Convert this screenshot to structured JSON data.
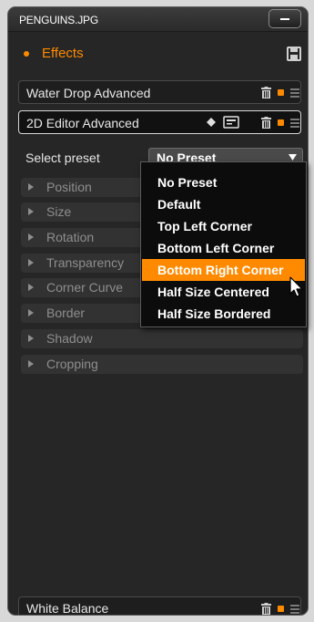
{
  "titlebar": {
    "file_name": "PENGUINS.JPG"
  },
  "effects_header": {
    "label": "Effects"
  },
  "effects": [
    {
      "label": "Water Drop Advanced"
    },
    {
      "label": "2D Editor Advanced"
    },
    {
      "label": "White Balance"
    }
  ],
  "preset": {
    "label": "Select preset",
    "selected": "No Preset",
    "options": [
      "No Preset",
      "Default",
      "Top Left Corner",
      "Bottom Left Corner",
      "Bottom Right Corner",
      "Half Size Centered",
      "Half Size Bordered"
    ],
    "highlighted": "Bottom Right Corner"
  },
  "sections": [
    "Position",
    "Size",
    "Rotation",
    "Transparency",
    "Corner Curve",
    "Border",
    "Shadow",
    "Cropping"
  ],
  "colors": {
    "accent": "#ff8a00",
    "panel": "#262626",
    "highlight": "#ff8a00"
  },
  "icons": [
    "minimize-icon",
    "save-icon",
    "trash-icon",
    "keyframe-icon",
    "monitor-icon",
    "menu-icon",
    "expand-triangle-icon",
    "dropdown-arrow-icon",
    "mouse-cursor-icon"
  ]
}
